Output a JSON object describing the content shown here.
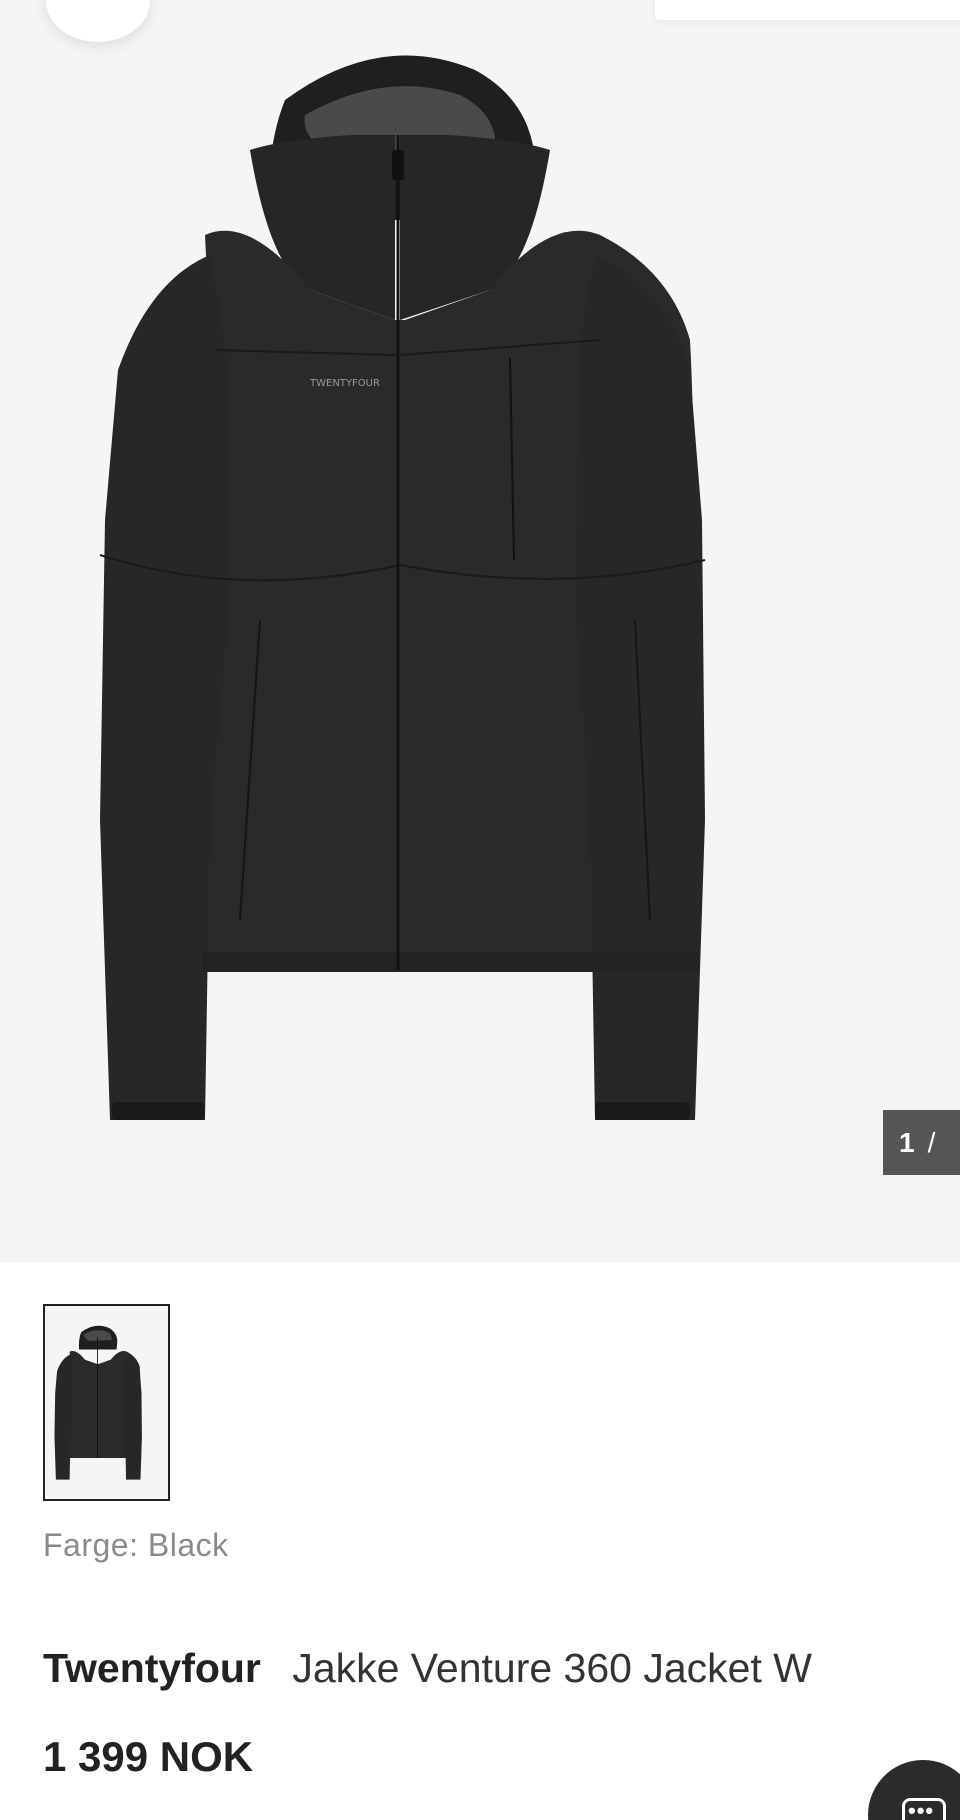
{
  "gallery": {
    "counter_current": "1",
    "counter_separator": "/",
    "main_image_icon": "jacket-product-image",
    "jacket_logo_text": "TWENTYFOUR"
  },
  "product": {
    "color_label": "Farge: Black",
    "brand": "Twentyfour",
    "name": "Jakke Venture 360 Jacket W",
    "price": "1 399 NOK"
  },
  "colors": {
    "image_background": "#f5f5f5",
    "jacket": "#2a2a2a",
    "counter_bg": "#555555",
    "chat_bg": "#2b2b2b"
  },
  "icons": {
    "wishlist": "heart-icon",
    "chat": "chat-icon"
  }
}
